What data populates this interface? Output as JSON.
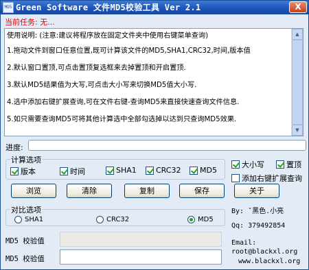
{
  "window": {
    "title": "Green Software 文件MD5校验工具 Ver 2.1",
    "icon_text": "MD5",
    "close_label": "X"
  },
  "task": {
    "label": "当前任务:",
    "value": "无..."
  },
  "notes": {
    "lines": [
      "使用说明:  (注意:建议将程序放在固定文件夹中使用右键菜单查询)",
      "1.拖动文件到窗口任意位置,既可计算该文件的MD5,SHA1,CRC32,时间,版本值",
      "2.默认窗口置顶,可点击置顶复选框来去掉置顶和开启置顶.",
      "3.默认MD5结果值为大写,可点击大小写来切换MD5值大小写.",
      "4.选中添加右键扩展查询,可在文件右键-查询MD5来直接快速查询文件信息.",
      "5.如只需要查询MD5可将其他计算选中全部勾选掉以达到只查询MD5效果."
    ]
  },
  "progress": {
    "label": "进度:",
    "value_fraction": 0
  },
  "calc": {
    "group_label": "计算选项",
    "options": [
      {
        "label": "版本",
        "checked": true
      },
      {
        "label": "时间",
        "checked": true
      },
      {
        "label": "SHA1",
        "checked": true
      },
      {
        "label": "CRC32",
        "checked": true
      },
      {
        "label": "MD5",
        "checked": true
      }
    ]
  },
  "settings": {
    "uppercase": {
      "label": "大小写",
      "checked": true
    },
    "topmost": {
      "label": "置顶",
      "checked": true
    },
    "context_menu": {
      "label": "添加右键扩展查询",
      "checked": false
    }
  },
  "buttons": {
    "browse": "浏览",
    "clear": "清除",
    "copy": "复制",
    "save": "保存",
    "about": "关于"
  },
  "compare": {
    "group_label": "对比选项",
    "options": [
      {
        "label": "SHA1",
        "selected": false
      },
      {
        "label": "CRC32",
        "selected": false
      },
      {
        "label": "MD5",
        "selected": true
      }
    ]
  },
  "fields": {
    "md5_check_1": {
      "label": "MD5 校验值",
      "value": ""
    },
    "md5_check_2": {
      "label": "MD5 校验值",
      "value": ""
    }
  },
  "about_info": {
    "by": "By: ˇ黑色.小亮",
    "qq": "Qq: 379492854",
    "email_label": "Email:",
    "email": "root@blackxl.org",
    "website": "www.blackxl.org"
  },
  "colors": {
    "titlebar": "#1d56b8",
    "task_text": "#e00000",
    "check_mark": "#21a121",
    "window_bg": "#e3ebf7"
  }
}
